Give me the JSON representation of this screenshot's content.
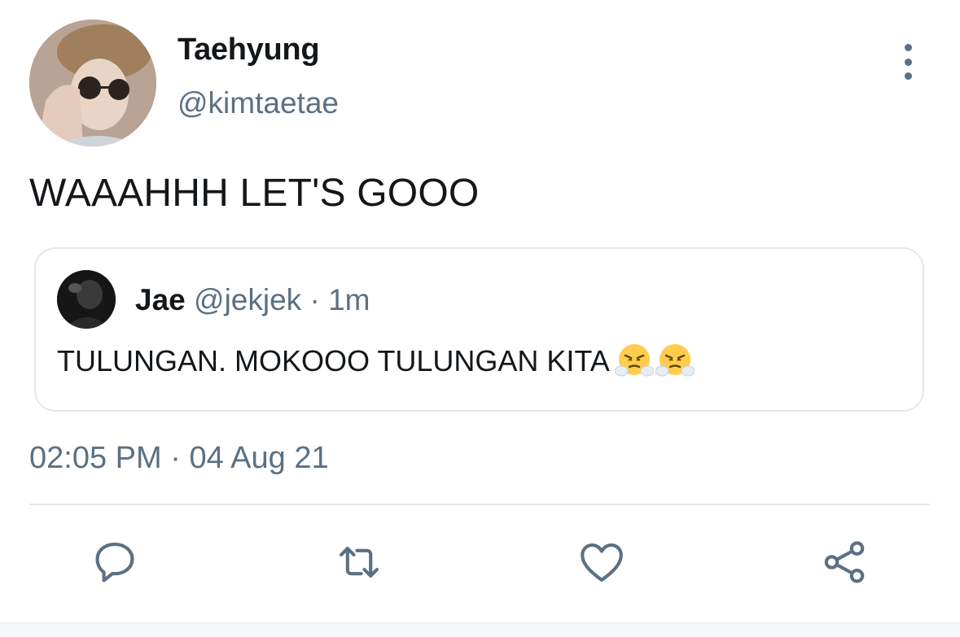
{
  "tweet": {
    "author": {
      "display_name": "Taehyung",
      "handle": "@kimtaetae"
    },
    "text": "WAAAHHH LET'S GOOO",
    "quoted": {
      "display_name": "Jae",
      "handle": "@jekjek",
      "separator": "·",
      "time": "1m",
      "text": "TULUNGAN. MOKOOO TULUNGAN KITA",
      "emojis": [
        "face-with-steam-emoji",
        "face-with-steam-emoji"
      ]
    },
    "time": "02:05 PM",
    "separator": "·",
    "date": "04 Aug 21"
  },
  "actions": [
    {
      "name": "reply",
      "icon": "reply-icon"
    },
    {
      "name": "retweet",
      "icon": "retweet-icon"
    },
    {
      "name": "like",
      "icon": "heart-icon"
    },
    {
      "name": "share",
      "icon": "share-icon"
    }
  ],
  "colors": {
    "text_primary": "#14171a",
    "text_secondary": "#5b7083",
    "border": "#e1e8ed",
    "emoji_yellow": "#ffcc4d"
  }
}
